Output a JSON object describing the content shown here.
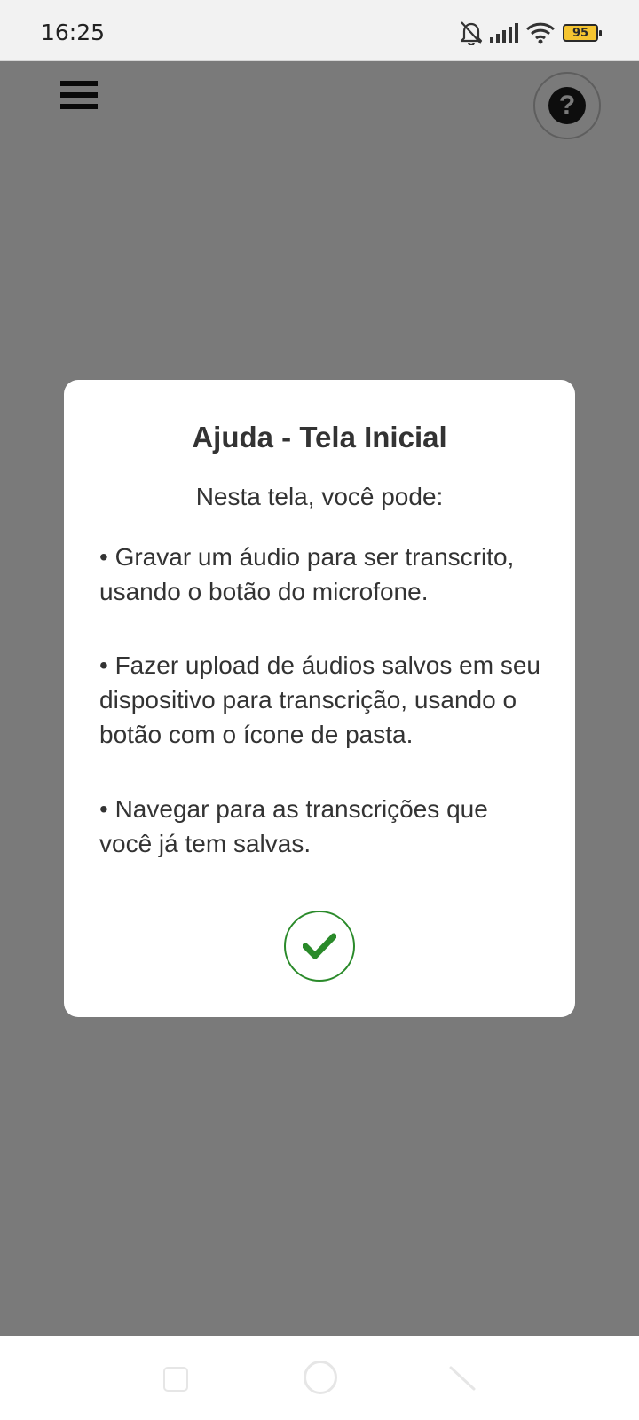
{
  "status_bar": {
    "time": "16:25",
    "battery": "95",
    "icons": [
      "bell-off-icon",
      "signal-icon",
      "wifi-icon",
      "battery-icon"
    ]
  },
  "app": {
    "menu_icon": "hamburger-menu-icon",
    "help_icon": "help-circle-icon"
  },
  "dialog": {
    "title": "Ajuda - Tela Inicial",
    "subtitle": "Nesta tela, você pode:",
    "items": [
      "• Gravar um áudio para ser transcrito, usando o botão do microfone.",
      "• Fazer upload de áudios salvos em seu dispositivo para transcrição, usando o botão com o ícone de pasta.",
      "• Navegar para as transcrições que você já tem salvas."
    ],
    "confirm_icon": "check-icon",
    "confirm_color": "#2a8a2a"
  },
  "nav_bar": {
    "icons": [
      "recents-square-icon",
      "home-circle-icon",
      "back-triangle-icon"
    ]
  },
  "colors": {
    "overlay": "#7a7a7a",
    "dialog_bg": "#ffffff",
    "text": "#333333",
    "battery": "#f5c531"
  }
}
